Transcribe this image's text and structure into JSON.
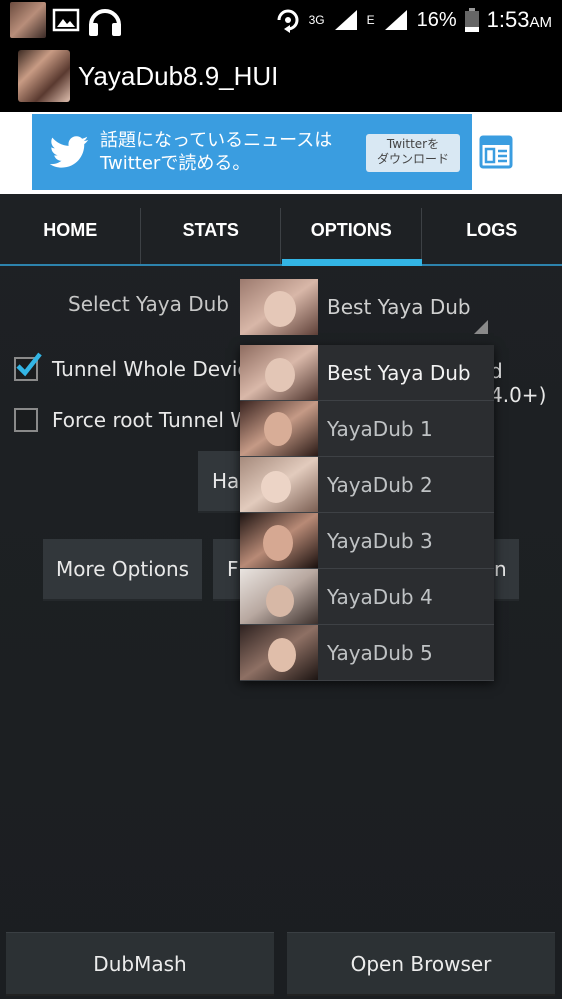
{
  "status_bar": {
    "network": "3G",
    "network2": "E",
    "battery": "16%",
    "time": "1:53",
    "ampm": "AM"
  },
  "action_bar": {
    "title": "YayaDub8.9_HUI"
  },
  "ad": {
    "line1": "話題になっているニュースは",
    "line2": "Twitterで読める。",
    "button_line1": "Twitterを",
    "button_line2": "ダウンロード"
  },
  "tabs": [
    {
      "label": "HOME"
    },
    {
      "label": "STATS"
    },
    {
      "label": "OPTIONS"
    },
    {
      "label": "LOGS"
    }
  ],
  "active_tab": "OPTIONS",
  "options": {
    "select_label": "Select Yaya Dub",
    "spinner_value": "Best Yaya Dub",
    "tunnel_whole_device": {
      "label": "Tunnel Whole Devic",
      "suffix": "d 4.0+)",
      "checked": true
    },
    "force_root": {
      "label": "Force root Tunnel W",
      "checked": false
    },
    "ha_button": "Ha",
    "more_options_button": "More Options",
    "f_button": "F",
    "n_button": "n"
  },
  "dropdown": {
    "items": [
      {
        "label": "Best Yaya Dub"
      },
      {
        "label": "YayaDub 1"
      },
      {
        "label": "YayaDub 2"
      },
      {
        "label": "YayaDub 3"
      },
      {
        "label": "YayaDub 4"
      },
      {
        "label": "YayaDub 5"
      }
    ]
  },
  "bottom": {
    "dubmash": "DubMash",
    "open_browser": "Open Browser"
  },
  "colors": {
    "accent": "#33b5e5",
    "twitter_blue": "#3a9de0",
    "background": "#1e2124"
  }
}
